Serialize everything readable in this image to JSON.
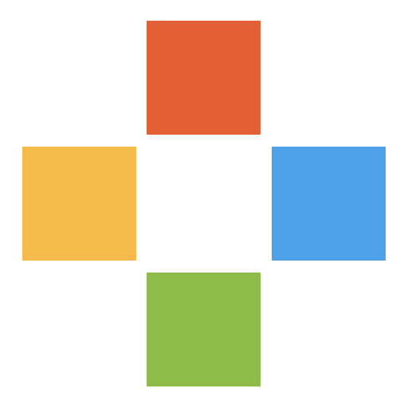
{
  "logo": {
    "tiles": [
      {
        "id": "top",
        "color": "#E35F36"
      },
      {
        "id": "left",
        "color": "#F5BA4C"
      },
      {
        "id": "right",
        "color": "#4FA1E9"
      },
      {
        "id": "bottom",
        "color": "#8FBB4B"
      }
    ]
  }
}
